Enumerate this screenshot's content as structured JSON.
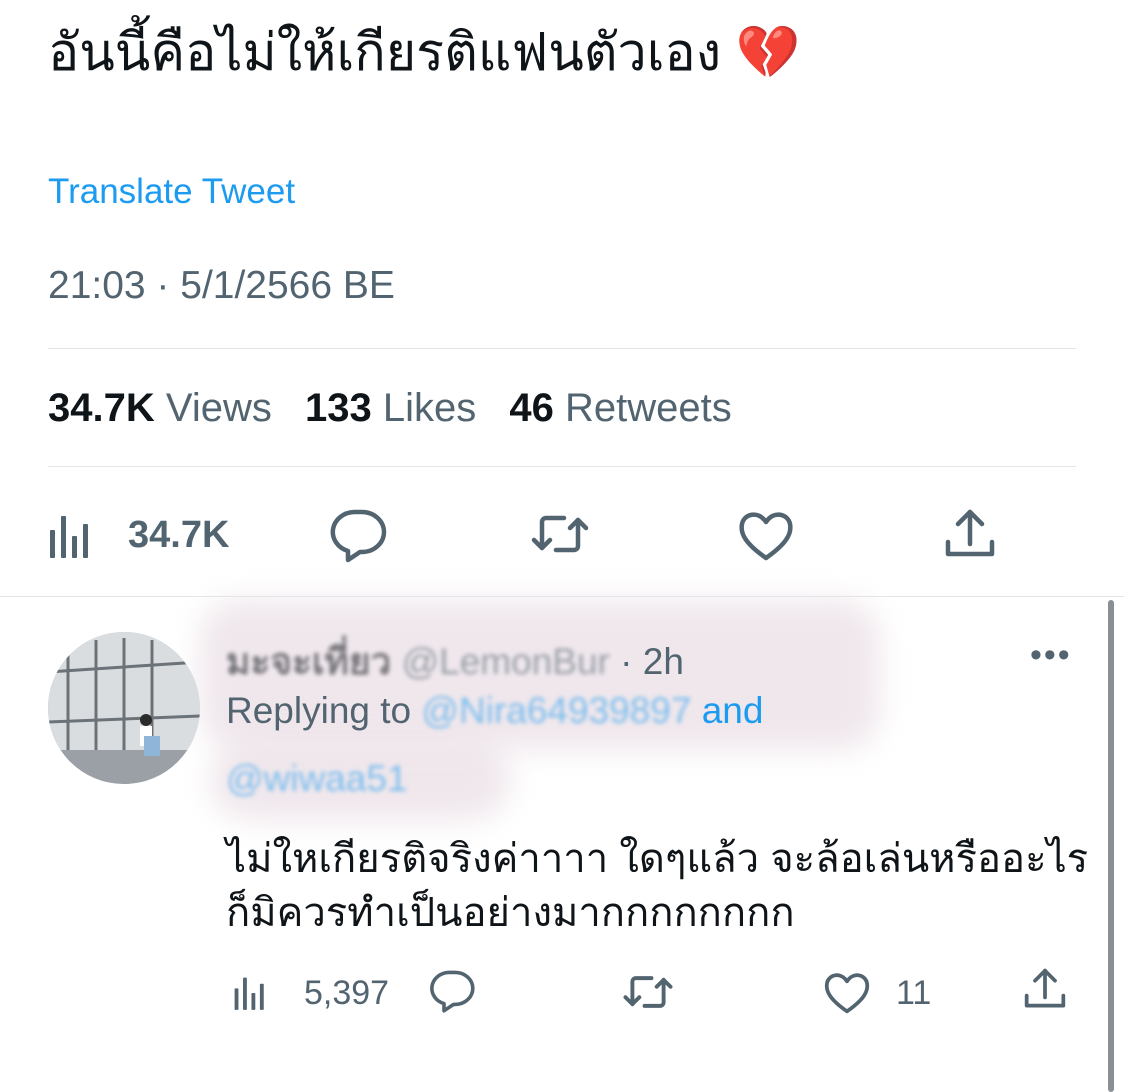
{
  "tweet": {
    "text": "อันนี้คือไม่ให้เกียรติแฟนตัวเอง 💔",
    "translate_label": "Translate Tweet",
    "timestamp": "21:03 · 5/1/2566 BE",
    "stats": {
      "views_count": "34.7K",
      "views_label": "Views",
      "likes_count": "133",
      "likes_label": "Likes",
      "retweets_count": "46",
      "retweets_label": "Retweets"
    },
    "actions": {
      "views_count": "34.7K",
      "icons": [
        "views-icon",
        "reply-icon",
        "retweet-icon",
        "like-icon",
        "share-icon"
      ]
    }
  },
  "reply": {
    "display_name": "มะจะเที่ยว",
    "handle": "@LemonBur",
    "time": "· 2h",
    "more": "•••",
    "replying_prefix": "Replying to",
    "replying_users": "@Nira64939897",
    "replying_and": "and",
    "replying_users2": "@wiwaa51",
    "text": "ไม่ใหเกียรติจริงค่าาาา ใดๆแล้ว จะล้อเล่นหรืออะไร ก็มิควรทำเป็นอย่างมากกกกกกกก",
    "views_count": "5,397",
    "likes_count": "11"
  },
  "colors": {
    "accent": "#1d9bf0",
    "secondary_text": "#536471",
    "primary_text": "#0f1419",
    "heart_broken": "#e0245e"
  }
}
